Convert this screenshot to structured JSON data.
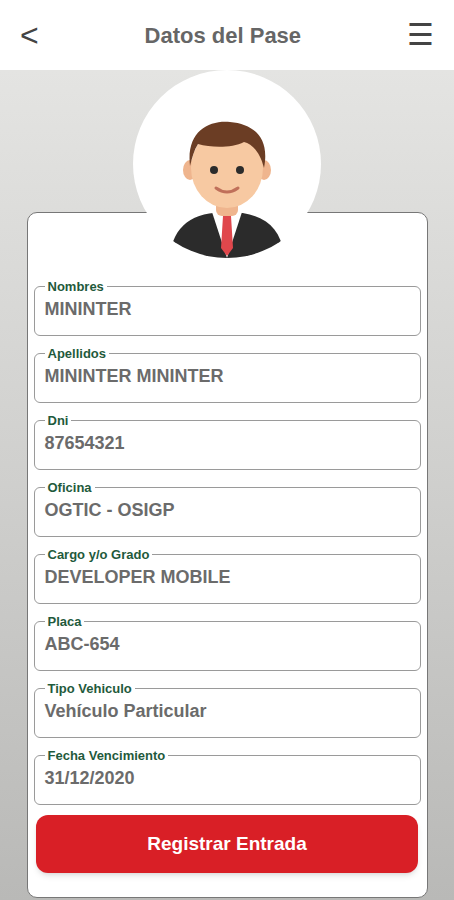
{
  "header": {
    "back": "<",
    "title": "Datos del Pase",
    "menu": "☰"
  },
  "fields": [
    {
      "label": "Nombres",
      "value": "MININTER"
    },
    {
      "label": "Apellidos",
      "value": "MININTER MININTER"
    },
    {
      "label": "Dni",
      "value": "87654321"
    },
    {
      "label": "Oficina",
      "value": "OGTIC - OSIGP"
    },
    {
      "label": "Cargo y/o Grado",
      "value": "DEVELOPER MOBILE"
    },
    {
      "label": "Placa",
      "value": "ABC-654"
    },
    {
      "label": "Tipo Vehiculo",
      "value": "Vehículo Particular"
    },
    {
      "label": "Fecha Vencimiento",
      "value": "31/12/2020"
    }
  ],
  "button": "Registrar Entrada"
}
